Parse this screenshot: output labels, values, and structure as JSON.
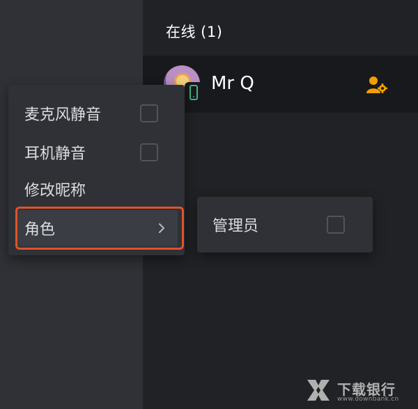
{
  "member_list": {
    "section_header": "在线 (1)",
    "members": [
      {
        "name": "Mr Q",
        "status": "mobile",
        "status_color": "#43b581",
        "role_icon": "user-gear-icon",
        "role_icon_color": "#f0a000"
      }
    ]
  },
  "context_menu": {
    "items": [
      {
        "label": "麦克风静音",
        "type": "checkbox",
        "checked": false
      },
      {
        "label": "耳机静音",
        "type": "checkbox",
        "checked": false
      },
      {
        "label": "修改昵称",
        "type": "action"
      },
      {
        "label": "角色",
        "type": "submenu",
        "icon": "chevron-right-icon",
        "highlighted": true
      }
    ]
  },
  "submenu": {
    "items": [
      {
        "label": "管理员",
        "type": "checkbox",
        "checked": false
      }
    ]
  },
  "watermark": {
    "title": "下载银行",
    "url": "www.downbank.cn"
  },
  "colors": {
    "sidebar_bg": "#2f3136",
    "main_bg": "#202225",
    "member_row_bg": "#18191c",
    "highlight_border": "#e05328",
    "text": "#dcddde"
  }
}
